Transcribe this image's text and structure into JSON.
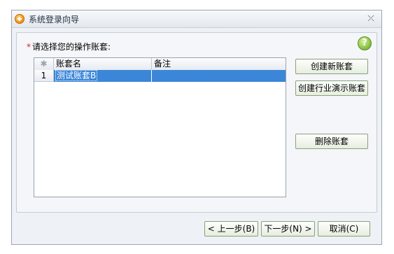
{
  "window": {
    "title": "系统登录向导",
    "close_glyph": "⤫"
  },
  "prompt": {
    "required_mark": "*",
    "label": "请选择您的操作账套:"
  },
  "help": {
    "glyph": "?"
  },
  "grid": {
    "selector_header": "✱",
    "columns": [
      "账套名",
      "备注"
    ],
    "rows": [
      {
        "num": "1",
        "name": "测试账套B",
        "note": ""
      }
    ]
  },
  "side_buttons": {
    "create_new": "创建新账套",
    "create_demo": "创建行业演示账套",
    "delete": "删除账套"
  },
  "nav_buttons": {
    "prev": "< 上一步(B)",
    "next": "下一步(N) >",
    "cancel": "取消(C)"
  }
}
